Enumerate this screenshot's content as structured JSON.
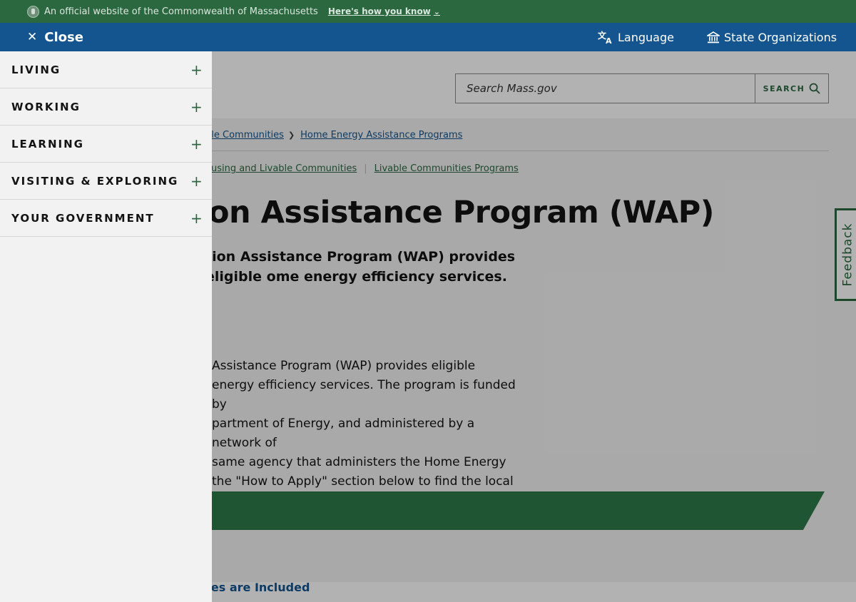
{
  "banner": {
    "text": "An official website of the Commonwealth of Massachusetts",
    "link": "Here's how you know"
  },
  "util_nav": {
    "close": "Close",
    "language": "Language",
    "state_orgs": "State Organizations"
  },
  "search": {
    "placeholder": "Search Mass.gov",
    "button": "SEARCH"
  },
  "breadcrumbs": [
    "ble Communities",
    "Home Energy Assistance Programs"
  ],
  "tags": [
    "ousing and Livable Communities",
    "Livable Communities Programs"
  ],
  "page": {
    "title": "on Assistance Program (WAP)",
    "lede": "tion Assistance Program (WAP) provides eligible ome energy efficiency services.",
    "body": [
      "Assistance Program (WAP) provides eligible",
      "energy efficiency services. The program is funded by",
      "partment of Energy, and administered by a network of",
      "same agency that administers the Home Energy",
      "the \"How to Apply\" section below to find the local"
    ],
    "toc_link": "res are Included"
  },
  "feedback": "Feedback",
  "menu": {
    "items": [
      {
        "label": "LIVING"
      },
      {
        "label": "WORKING"
      },
      {
        "label": "LEARNING"
      },
      {
        "label": "VISITING & EXPLORING"
      },
      {
        "label": "YOUR GOVERNMENT"
      }
    ],
    "expand_symbol": "+"
  },
  "colors": {
    "banner_green": "#2b6840",
    "nav_blue": "#14558f",
    "accent_green": "#2e7a4b"
  }
}
